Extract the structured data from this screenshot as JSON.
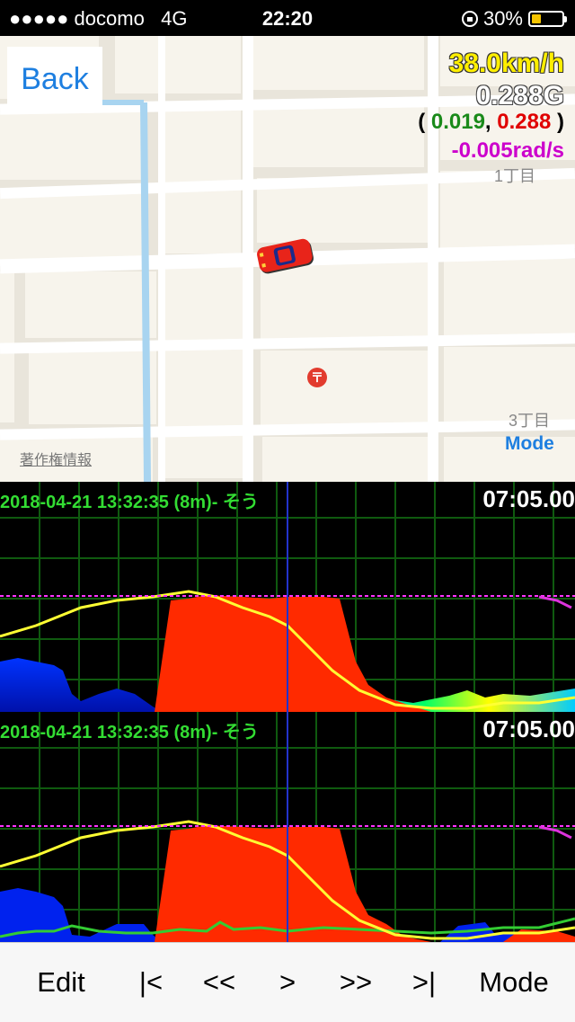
{
  "status_bar": {
    "carrier": "●●●●● docomo",
    "network": "4G",
    "time": "22:20",
    "battery": "30%"
  },
  "map": {
    "back_label": "Back",
    "speed": "38.0km/h",
    "g_total": "0.288G",
    "g_open": "(",
    "g_x": "0.019",
    "g_sep": ",",
    "g_y": "0.288",
    "g_close": ")",
    "yaw_rate": "-0.005rad/s",
    "area_label_1": "1丁目",
    "area_label_3": "3丁目",
    "copyright": "著作権情報",
    "mode_label": "Mode",
    "post_icon": "post-office-icon",
    "car_icon": "red-car-icon"
  },
  "graph1": {
    "title": "2018-04-21 13:32:35 (8m)- そう",
    "time": "07:05.00"
  },
  "graph2": {
    "title": "2018-04-21 13:32:35 (8m)- そう",
    "time": "07:05.00"
  },
  "toolbar": {
    "edit": "Edit",
    "first": "|<",
    "rewind": "<<",
    "play": ">",
    "forward": ">>",
    "last": ">|",
    "mode": "Mode"
  },
  "colors": {
    "accent": "#1e7fe0",
    "speed": "#ffef00",
    "gx": "#1a8a1a",
    "gy": "#e00000",
    "yaw": "#cc00cc",
    "grid": "#0f5a0f"
  }
}
